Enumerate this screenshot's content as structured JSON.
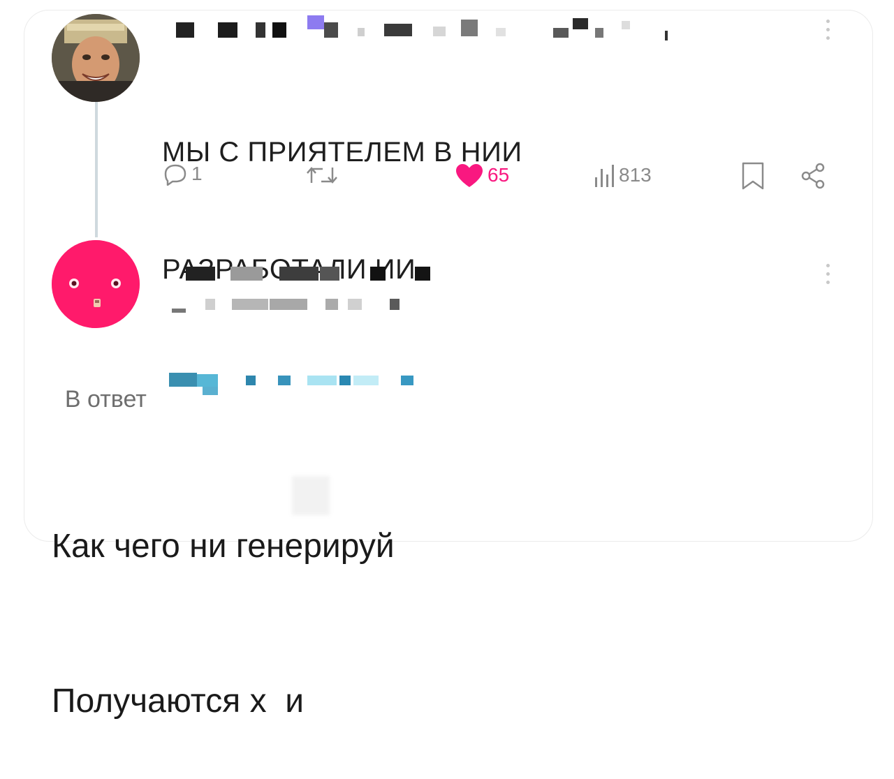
{
  "post": {
    "text_line1": "МЫ С ПРИЯТЕЛЕМ В НИИ",
    "text_line2": "РАЗРАБОТАЛИ ИИ",
    "actions": {
      "replies": "1",
      "retweets": "",
      "likes": "65",
      "views": "813"
    }
  },
  "reply": {
    "reply_to_label": "В ответ",
    "text_line1": "Как чего ни генерируй",
    "text_line2": "Получаются х  и"
  },
  "colors": {
    "like": "#f91880",
    "icon_gray": "#8a8a8a",
    "thread_line": "#cfd9de",
    "link": "#1d9bf0"
  },
  "icons": {
    "reply": "reply-icon",
    "retweet": "retweet-icon",
    "like": "heart-icon",
    "views": "views-icon",
    "bookmark": "bookmark-icon",
    "share": "share-icon",
    "more": "more-vertical-icon"
  }
}
